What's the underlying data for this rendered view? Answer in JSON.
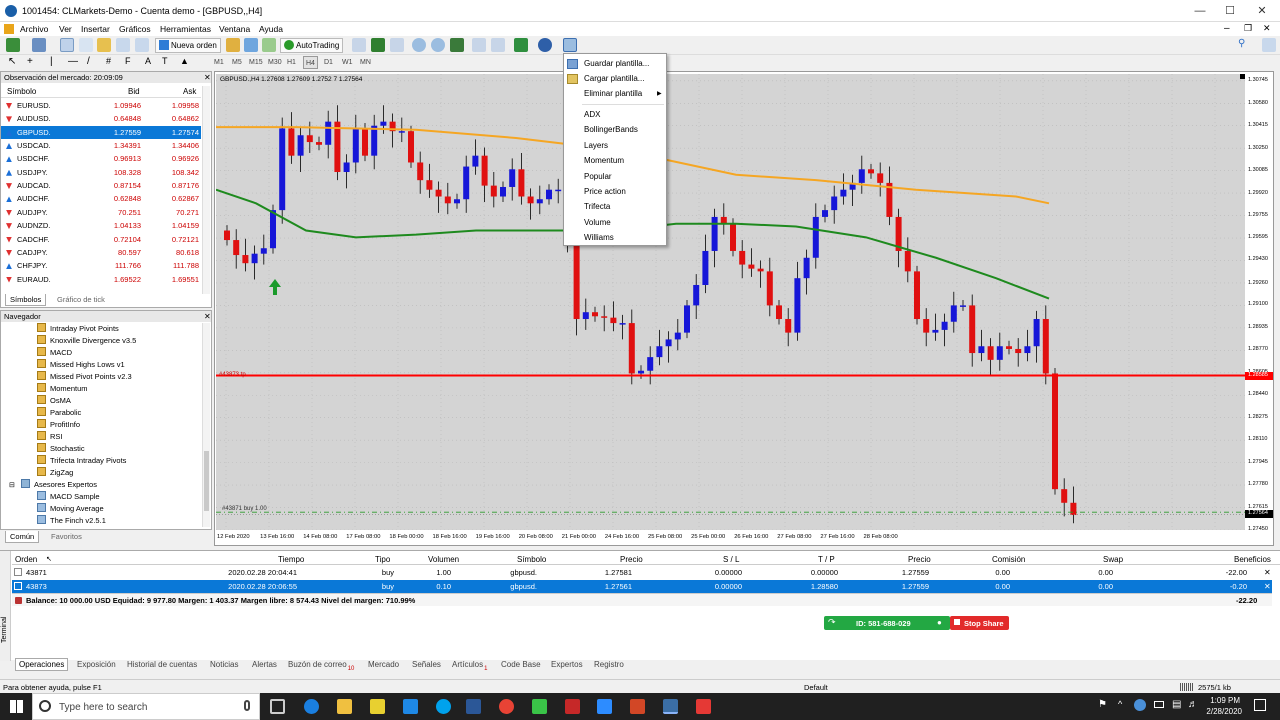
{
  "titlebar": {
    "title": "1001454: CLMarkets-Demo - Cuenta demo - [GBPUSD,,H4]"
  },
  "menu": [
    "Archivo",
    "Ver",
    "Insertar",
    "Gráficos",
    "Herramientas",
    "Ventana",
    "Ayuda"
  ],
  "toolbar": {
    "new_order": "Nueva orden",
    "autotrading": "AutoTrading"
  },
  "timeframes": [
    "M1",
    "M5",
    "M15",
    "M30",
    "H1",
    "H4",
    "D1",
    "W1",
    "MN"
  ],
  "market_watch": {
    "header": "Observación del mercado: 20:09:09",
    "cols": [
      "Símbolo",
      "Bid",
      "Ask"
    ],
    "rows": [
      {
        "sym": "EURUSD.",
        "bid": "1.09946",
        "ask": "1.09958"
      },
      {
        "sym": "AUDUSD.",
        "bid": "0.64848",
        "ask": "0.64862"
      },
      {
        "sym": "GBPUSD.",
        "bid": "1.27559",
        "ask": "1.27574"
      },
      {
        "sym": "USDCAD.",
        "bid": "1.34391",
        "ask": "1.34406"
      },
      {
        "sym": "USDCHF.",
        "bid": "0.96913",
        "ask": "0.96926"
      },
      {
        "sym": "USDJPY.",
        "bid": "108.328",
        "ask": "108.342"
      },
      {
        "sym": "AUDCAD.",
        "bid": "0.87154",
        "ask": "0.87176"
      },
      {
        "sym": "AUDCHF.",
        "bid": "0.62848",
        "ask": "0.62867"
      },
      {
        "sym": "AUDJPY.",
        "bid": "70.251",
        "ask": "70.271"
      },
      {
        "sym": "AUDNZD.",
        "bid": "1.04133",
        "ask": "1.04159"
      },
      {
        "sym": "CADCHF.",
        "bid": "0.72104",
        "ask": "0.72121"
      },
      {
        "sym": "CADJPY.",
        "bid": "80.597",
        "ask": "80.618"
      },
      {
        "sym": "CHFJPY.",
        "bid": "111.766",
        "ask": "111.788"
      },
      {
        "sym": "EURAUD.",
        "bid": "1.69522",
        "ask": "1.69551"
      }
    ],
    "tabs": [
      "Símbolos",
      "Gráfico de tick"
    ]
  },
  "navigator": {
    "header": "Navegador",
    "items": [
      "Intraday Pivot Points",
      "Knoxville Divergence v3.5",
      "MACD",
      "Missed Highs Lows v1",
      "Missed Pivot Points v2.3",
      "Momentum",
      "OsMA",
      "Parabolic",
      "ProfitInfo",
      "RSI",
      "Stochastic",
      "Trifecta Intraday Pivots",
      "ZigZag"
    ],
    "experts_folder": "Asesores Expertos",
    "experts": [
      "MACD Sample",
      "Moving Average",
      "The Finch v2.5.1"
    ],
    "tabs": [
      "Común",
      "Favoritos"
    ]
  },
  "chart": {
    "header": "GBPUSD.,H4  1.27608 1.27609 1.2752 7 1.27564",
    "price_ticks": [
      "1.30745",
      "1.30580",
      "1.30415",
      "1.30250",
      "1.30085",
      "1.29920",
      "1.29755",
      "1.29595",
      "1.29430",
      "1.29260",
      "1.29100",
      "1.28935",
      "1.28770",
      "1.28605",
      "1.28440",
      "1.28275",
      "1.28110",
      "1.27945",
      "1.27780",
      "1.27615",
      "1.27450"
    ],
    "current_price": "1.27564",
    "hline_price": "1.28585",
    "hline_label": "#43873 tp",
    "order_label": "#43871 buy 1.00",
    "date_ticks": [
      "12 Feb 2020",
      "13 Feb 16:00",
      "14 Feb 08:00",
      "17 Feb 08:00",
      "18 Feb 00:00",
      "18 Feb 16:00",
      "19 Feb 16:00",
      "20 Feb 08:00",
      "21 Feb 00:00",
      "24 Feb 16:00",
      "25 Feb 08:00",
      "25 Feb 00:00",
      "26 Feb 16:00",
      "27 Feb 08:00",
      "27 Feb 16:00",
      "28 Feb 08:00"
    ]
  },
  "template_menu": {
    "items": [
      "Guardar plantilla...",
      "Cargar plantilla...",
      "Eliminar plantilla"
    ],
    "templates": [
      "ADX",
      "BollingerBands",
      "Layers",
      "Momentum",
      "Popular",
      "Price action",
      "Trifecta",
      "Volume",
      "Williams"
    ]
  },
  "terminal": {
    "cols": [
      "Orden",
      "Tiempo",
      "Tipo",
      "Volumen",
      "Símbolo",
      "Precio",
      "S / L",
      "T / P",
      "Precio",
      "Comisión",
      "Swap",
      "Beneficios"
    ],
    "rows": [
      [
        "43871",
        "2020.02.28 20:04:41",
        "buy",
        "1.00",
        "gbpusd.",
        "1.27581",
        "0.00000",
        "0.00000",
        "1.27559",
        "0.00",
        "0.00",
        "-22.00"
      ],
      [
        "43873",
        "2020.02.28 20:06:55",
        "buy",
        "0.10",
        "gbpusd.",
        "1.27561",
        "0.00000",
        "1.28580",
        "1.27559",
        "0.00",
        "0.00",
        "-0.20"
      ]
    ],
    "balance": "Balance: 10 000.00 USD  Equidad: 9 977.80  Margen: 1 403.37  Margen libre: 8 574.43  Nivel del margen: 710.99%",
    "balance_total": "-22.20",
    "tabs": [
      "Operaciones",
      "Exposición",
      "Historial de cuentas",
      "Noticias",
      "Alertas",
      "Buzón de correo",
      "Mercado",
      "Señales",
      "Artículos",
      "Code Base",
      "Expertos",
      "Registro"
    ],
    "side_label": "Terminal",
    "mailbox_count": "10",
    "articles_count": "1"
  },
  "share": {
    "id": "ID: 581-688-029",
    "stop": "Stop Share"
  },
  "status": {
    "help": "Para obtener ayuda, pulse F1",
    "profile": "Default",
    "traffic": "2575/1 kb"
  },
  "taskbar": {
    "search": "Type here to search",
    "time": "1:09 PM",
    "date": "2/28/2020"
  },
  "colors": {
    "bull": "#1616d8",
    "bear": "#e01010",
    "ma_orange": "#f5a623",
    "ma_green": "#1e8a1e",
    "hline": "#ff0000"
  }
}
